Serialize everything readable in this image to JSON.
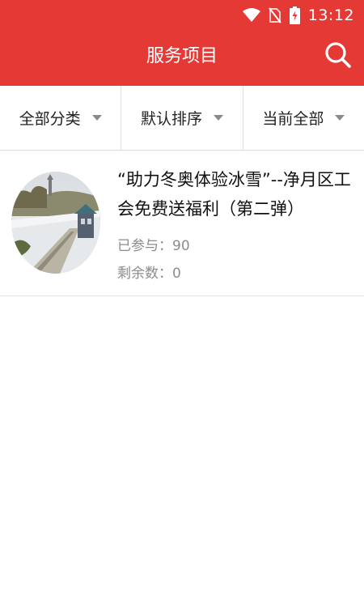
{
  "status_bar": {
    "time": "13:12",
    "icons": [
      "wifi-icon",
      "no-sim-icon",
      "battery-charging-icon"
    ]
  },
  "header": {
    "title": "服务项目",
    "search_icon": "search-icon"
  },
  "filters": [
    {
      "label": "全部分类"
    },
    {
      "label": "默认排序"
    },
    {
      "label": "当前全部"
    }
  ],
  "items": [
    {
      "title": "“助力冬奥体验冰雪”--净月区工会免费送福利（第二弹）",
      "joined_label": "已参与：",
      "joined": "90",
      "remaining_label": "剩余数：",
      "remaining": "0"
    }
  ],
  "colors": {
    "primary": "#e53935",
    "text": "#111111",
    "muted": "#8c8c8c"
  }
}
